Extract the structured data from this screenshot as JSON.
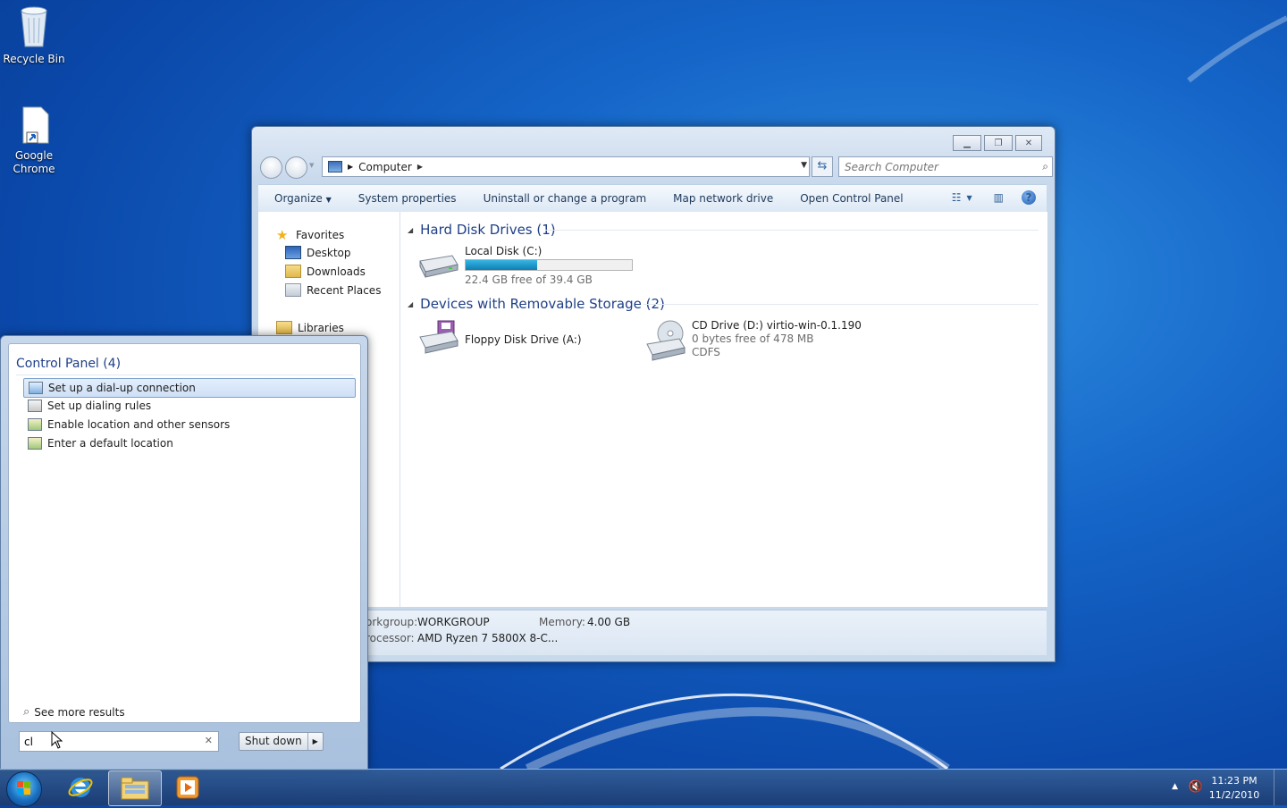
{
  "desktop": {
    "icons": [
      {
        "label": "Recycle Bin",
        "icon": "recycle-bin-icon"
      },
      {
        "label": "Google Chrome",
        "icon": "chrome-shortcut-icon"
      }
    ]
  },
  "explorer": {
    "address": {
      "crumb": "Computer"
    },
    "search": {
      "placeholder": "Search Computer"
    },
    "toolbar": {
      "organize": "Organize",
      "system_properties": "System properties",
      "uninstall": "Uninstall or change a program",
      "map_drive": "Map network drive",
      "open_cp": "Open Control Panel"
    },
    "nav": {
      "favorites": "Favorites",
      "desktop": "Desktop",
      "downloads": "Downloads",
      "recent": "Recent Places",
      "libraries": "Libraries"
    },
    "groups": {
      "hdd": {
        "title": "Hard Disk Drives (1)"
      },
      "removable": {
        "title": "Devices with Removable Storage (2)"
      }
    },
    "drives": {
      "c": {
        "name": "Local Disk (C:)",
        "free": "22.4 GB free of 39.4 GB",
        "used_fraction": 0.43
      },
      "a": {
        "name": "Floppy Disk Drive (A:)"
      },
      "d": {
        "name": "CD Drive (D:) virtio-win-0.1.190",
        "free": "0 bytes free of 478 MB",
        "fs": "CDFS"
      }
    },
    "details": {
      "workgroup_key": "orkgroup:",
      "workgroup_val": "WORKGROUP",
      "memory_key": "Memory:",
      "memory_val": "4.00 GB",
      "processor_key": "rocessor:",
      "processor_val": "AMD Ryzen 7 5800X 8-C..."
    }
  },
  "start_menu": {
    "header": "Control Panel (4)",
    "results": [
      "Set up a dial-up connection",
      "Set up dialing rules",
      "Enable location and other sensors",
      "Enter a default location"
    ],
    "see_more": "See more results",
    "search_value": "cl",
    "shutdown": "Shut down"
  },
  "taskbar": {
    "time": "11:23 PM",
    "date": "11/2/2010"
  },
  "colors": {
    "desktop_blue": "#1565c8",
    "link_blue": "#1e3f87",
    "progress": "#1f95cd"
  }
}
